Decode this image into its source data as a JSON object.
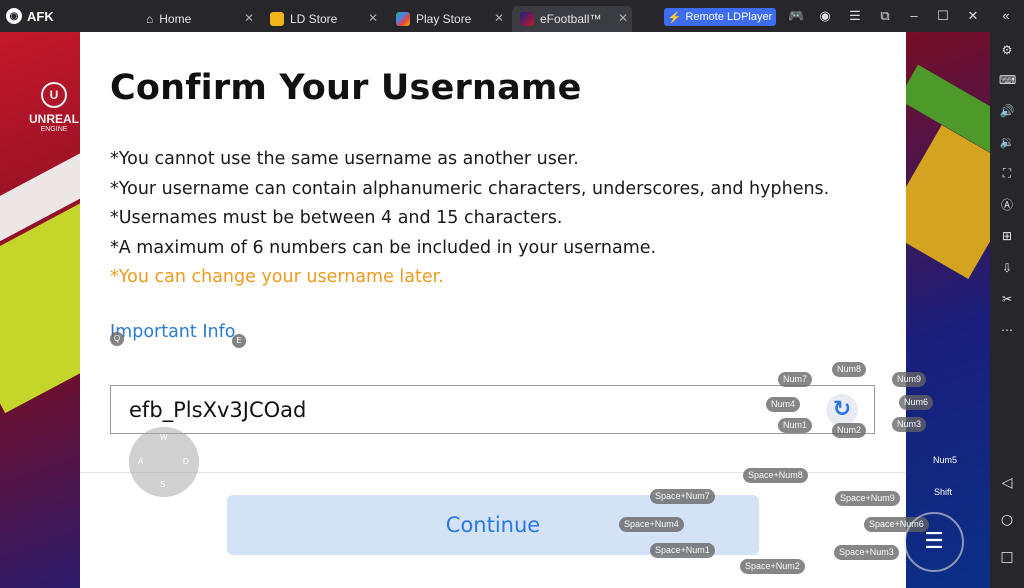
{
  "titlebar": {
    "app_name": "AFK",
    "tabs": [
      {
        "label": "Home",
        "closable": true
      },
      {
        "label": "LD Store",
        "closable": true
      },
      {
        "label": "Play Store",
        "closable": true
      },
      {
        "label": "eFootball™",
        "closable": true
      }
    ],
    "remote_button": "Remote LDPlayer"
  },
  "game": {
    "engine_logo": "UNREAL",
    "engine_sub": "ENGINE"
  },
  "dialog": {
    "title": "Confirm Your Username",
    "rules": [
      "*You cannot use the same username as another user.",
      "*Your username can contain alphanumeric characters, underscores, and hyphens.",
      "*Usernames must be between 4 and 15 characters.",
      "*A maximum of 6 numbers can be included in your username."
    ],
    "note": "*You can change your username later.",
    "important_link": "Important Info",
    "username_value": "efb_PlsXv3JCOad",
    "continue_label": "Continue"
  },
  "keymap": {
    "q": "Q",
    "e": "E",
    "dpad": {
      "up": "W",
      "left": "A",
      "right": "D",
      "down": "S"
    },
    "num7": "Num7",
    "num8": "Num8",
    "num9": "Num9",
    "num4": "Num4",
    "num6": "Num6",
    "num1": "Num1",
    "num2": "Num2",
    "num3": "Num3",
    "num5": "Num5",
    "shift": "Shift",
    "space_num8": "Space+Num8",
    "space_num7": "Space+Num7",
    "space_num9": "Space+Num9",
    "space_num4": "Space+Num4",
    "space_num6": "Space+Num6",
    "space_num1": "Space+Num1",
    "space_num3": "Space+Num3",
    "space_num2": "Space+Num2"
  },
  "colors": {
    "accent": "#2a78e6",
    "warning": "#ee9a1d",
    "remote_button": "#3d6bf2"
  }
}
